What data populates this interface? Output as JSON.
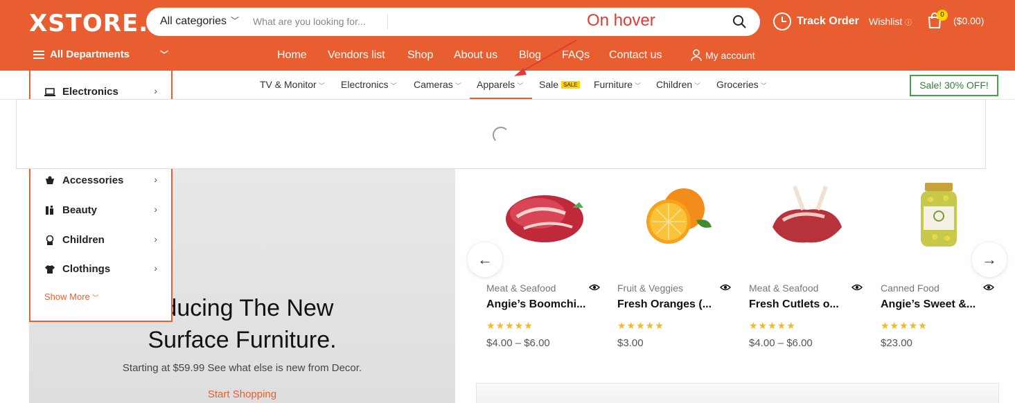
{
  "header": {
    "logo": "XSTORE.",
    "search": {
      "category": "All categories",
      "placeholder": "What are you looking for..."
    },
    "annotation": "On hover",
    "track_order": "Track Order",
    "wishlist": "Wishlist",
    "cart": {
      "count": "0",
      "total": "($0.00)"
    },
    "departments": "All Departments",
    "menu": [
      "Home",
      "Vendors list",
      "Shop",
      "About us",
      "Blog",
      "FAQs",
      "Contact us"
    ],
    "account": "My account"
  },
  "subnav": {
    "items": [
      "TV & Monitor",
      "Electronics",
      "Cameras",
      "Apparels",
      "Sale",
      "Furniture",
      "Children",
      "Groceries"
    ],
    "sale_badge": "SALE",
    "promo": "Sale! 30% OFF!"
  },
  "sidebar": {
    "items": [
      "Electronics",
      "Accessories",
      "Beauty",
      "Children",
      "Clothings"
    ],
    "show_more": "Show More"
  },
  "hero": {
    "title_line1": "oducing The New",
    "title_line2": "Surface Furniture.",
    "subtitle": "Starting at $59.99 See what else is new from Decor.",
    "cta": "Start Shopping"
  },
  "products": [
    {
      "category": "Meat & Seafood",
      "name": "Angie’s Boomchi...",
      "price": "$4.00 – $6.00",
      "rating": 5
    },
    {
      "category": "Fruit & Veggies",
      "name": "Fresh Oranges (...",
      "price": "$3.00",
      "rating": 5
    },
    {
      "category": "Meat & Seafood",
      "name": "Fresh Cutlets o...",
      "price": "$4.00 – $6.00",
      "rating": 5
    },
    {
      "category": "Canned Food",
      "name": "Angie’s Sweet &...",
      "price": "$23.00",
      "rating": 5
    }
  ],
  "colors": {
    "brand": "#e95e30",
    "sale_badge": "#ffd400",
    "promo": "#43a047",
    "stars": "#f5b823"
  }
}
